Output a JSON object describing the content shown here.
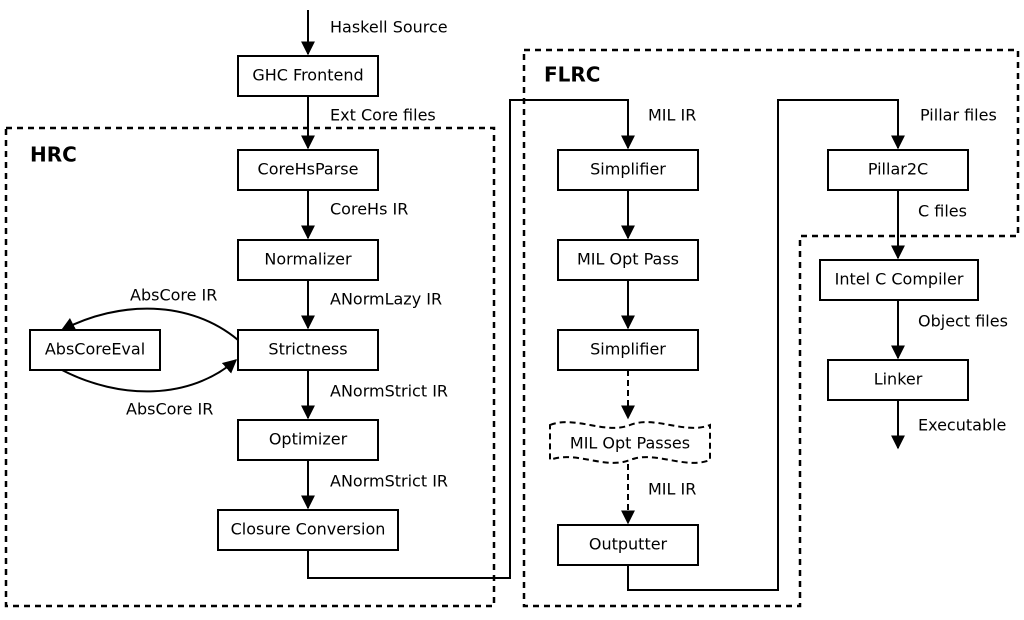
{
  "diagram": {
    "frames": {
      "hrc": {
        "title": "HRC"
      },
      "flrc": {
        "title": "FLRC"
      }
    },
    "nodes": {
      "ghc_frontend": "GHC Frontend",
      "corehs_parse": "CoreHsParse",
      "normalizer": "Normalizer",
      "strictness": "Strictness",
      "abscore_eval": "AbsCoreEval",
      "optimizer": "Optimizer",
      "closure_conv": "Closure Conversion",
      "simplifier1": "Simplifier",
      "mil_opt_pass": "MIL Opt Pass",
      "simplifier2": "Simplifier",
      "mil_opt_passes": "MIL Opt Passes",
      "outputter": "Outputter",
      "pillar2c": "Pillar2C",
      "intel_cc": "Intel C Compiler",
      "linker": "Linker"
    },
    "edges": {
      "haskell_source": "Haskell Source",
      "ext_core_files": "Ext Core files",
      "corehs_ir": "CoreHs IR",
      "anorm_lazy_ir": "ANormLazy IR",
      "abscore_ir_top": "AbsCore IR",
      "abscore_ir_bottom": "AbsCore IR",
      "anorm_strict_ir1": "ANormStrict IR",
      "anorm_strict_ir2": "ANormStrict IR",
      "mil_ir_in": "MIL IR",
      "mil_ir_out": "MIL IR",
      "pillar_files": "Pillar files",
      "c_files": "C files",
      "object_files": "Object files",
      "executable": "Executable"
    }
  }
}
